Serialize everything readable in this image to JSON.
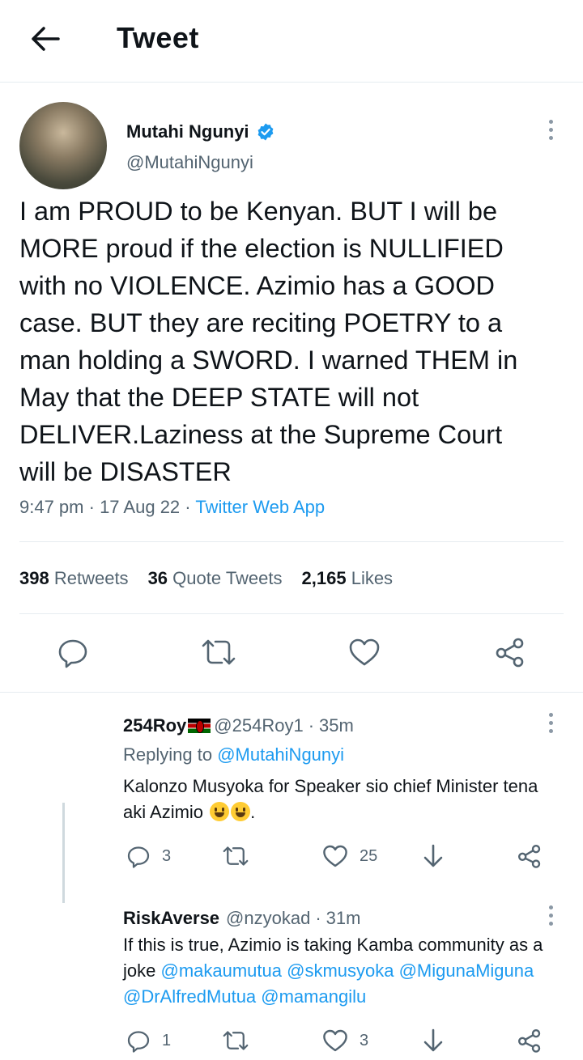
{
  "header": {
    "title": "Tweet"
  },
  "main_tweet": {
    "author_name": "Mutahi Ngunyi",
    "handle": "@MutahiNgunyi",
    "text": "I am PROUD to be Kenyan. BUT I will be\nMORE proud if the election is NULLIFIED\nwith no VIOLENCE. Azimio has a GOOD\ncase. BUT they are reciting POETRY to a\nman holding a SWORD. I warned THEM in\nMay that the DEEP STATE will not\nDELIVER.Laziness at the Supreme Court\nwill be DISASTER",
    "time": "9:47 pm",
    "date": "17 Aug 22",
    "separator": " · ",
    "source": "Twitter Web App",
    "retweets_count": "398",
    "retweets_label": "Retweets",
    "quote_count": "36",
    "quote_label": "Quote Tweets",
    "likes_count": "2,165",
    "likes_label": "Likes"
  },
  "replies": [
    {
      "name": "254Roy",
      "handle": "@254Roy1",
      "time": "35m",
      "replying_prefix": "Replying to ",
      "replying_to": "@MutahiNgunyi",
      "text": "Kalonzo  Musyoka for Speaker sio chief Minister tena aki Azimio",
      "text_suffix": ".",
      "reply_count": "3",
      "retweet_count": "",
      "like_count": "25"
    },
    {
      "name": "RiskAverse",
      "handle": "@nzyokad",
      "time": "31m",
      "text": "If this is true, Azimio is taking Kamba community as a joke ",
      "mentions": "@makaumutua @skmusyoka @MigunaMiguna @DrAlfredMutua @mamangilu",
      "reply_count": "1",
      "retweet_count": "",
      "like_count": "3"
    }
  ],
  "colors": {
    "accent": "#1d9bf0",
    "muted": "#536471",
    "icon": "#536471",
    "text": "#0f1419"
  }
}
